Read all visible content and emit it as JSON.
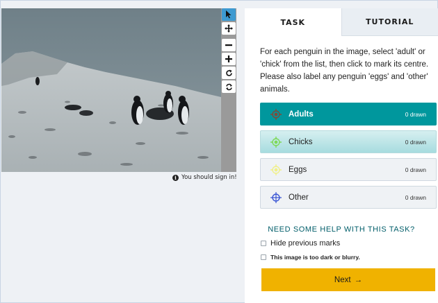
{
  "subject": {
    "signin_message": "You should sign in!"
  },
  "toolbar": {
    "icons": [
      "pointer-icon",
      "pan-icon",
      "zoom-out-icon",
      "zoom-in-icon",
      "rotate-icon",
      "reset-icon"
    ]
  },
  "tabs": [
    {
      "label": "TASK",
      "active": true
    },
    {
      "label": "TUTORIAL",
      "active": false
    }
  ],
  "instructions": "For each penguin in the image, select 'adult' or 'chick' from the list, then click to mark its centre. Please also label any penguin 'eggs' and 'other' animals.",
  "tools": [
    {
      "label": "Adults",
      "count": "0 drawn",
      "color": "#7e4b3a",
      "selected": true
    },
    {
      "label": "Chicks",
      "count": "0 drawn",
      "color": "#7ed957",
      "selected": false
    },
    {
      "label": "Eggs",
      "count": "0 drawn",
      "color": "#f0f08a",
      "selected": false
    },
    {
      "label": "Other",
      "count": "0 drawn",
      "color": "#3a56d4",
      "selected": false
    }
  ],
  "help_link": "NEED SOME HELP WITH THIS TASK?",
  "options": {
    "hide_marks": "Hide previous marks",
    "too_dark": "This image is too dark or blurry."
  },
  "next_button": {
    "label": "Next",
    "arrow": "→"
  },
  "colors": {
    "accent_teal": "#00979d",
    "next_yellow": "#f0b200",
    "toolbar_active": "#3d9ad1"
  }
}
